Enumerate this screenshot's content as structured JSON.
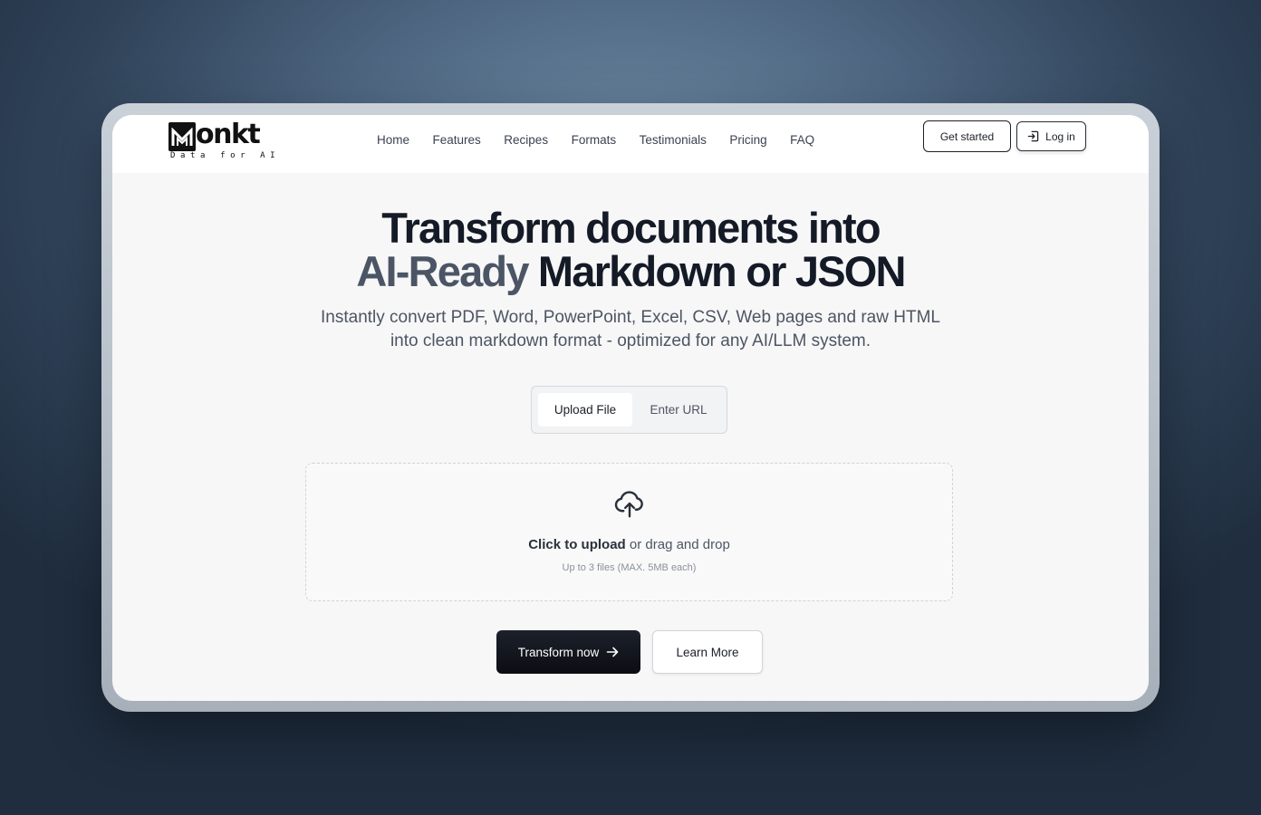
{
  "brand": {
    "name": "onkt",
    "tagline": "Data for AI"
  },
  "nav": {
    "items": [
      "Home",
      "Features",
      "Recipes",
      "Formats",
      "Testimonials",
      "Pricing",
      "FAQ"
    ],
    "get_started": "Get started",
    "login": "Log in"
  },
  "hero": {
    "title_line1": "Transform documents into",
    "title_accent": "AI-Ready",
    "title_line2_rest": " Markdown or JSON",
    "subtitle_line1": "Instantly convert PDF, Word, PowerPoint, Excel, CSV, Web pages and raw HTML",
    "subtitle_line2": "into clean markdown format - optimized for any AI/LLM system."
  },
  "input_mode": {
    "tabs": [
      "Upload File",
      "Enter URL"
    ],
    "selected": "Upload File"
  },
  "dropzone": {
    "icon": "cloud-upload-icon",
    "cta": "Click to upload",
    "cta_rest": " or drag and drop",
    "limit": "Up to 3 files (MAX. 5MB each)"
  },
  "actions": {
    "transform": "Transform now",
    "learn_more": "Learn More"
  }
}
